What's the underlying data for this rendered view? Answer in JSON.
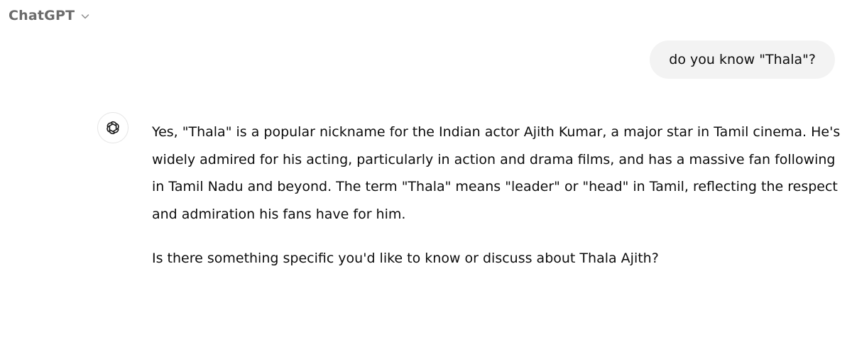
{
  "header": {
    "model_name": "ChatGPT",
    "dropdown_icon": "chevron-down-icon"
  },
  "conversation": {
    "user_message": "do you know \"Thala\"?",
    "assistant_avatar_icon": "openai-logo-icon",
    "assistant_paragraphs": [
      "Yes, \"Thala\" is a popular nickname for the Indian actor Ajith Kumar, a major star in Tamil cinema. He's widely admired for his acting, particularly in action and drama films, and has a massive fan following in Tamil Nadu and beyond. The term \"Thala\" means \"leader\" or \"head\" in Tamil, reflecting the respect and admiration his fans have for him.",
      "Is there something specific you'd like to know or discuss about Thala Ajith?"
    ]
  }
}
